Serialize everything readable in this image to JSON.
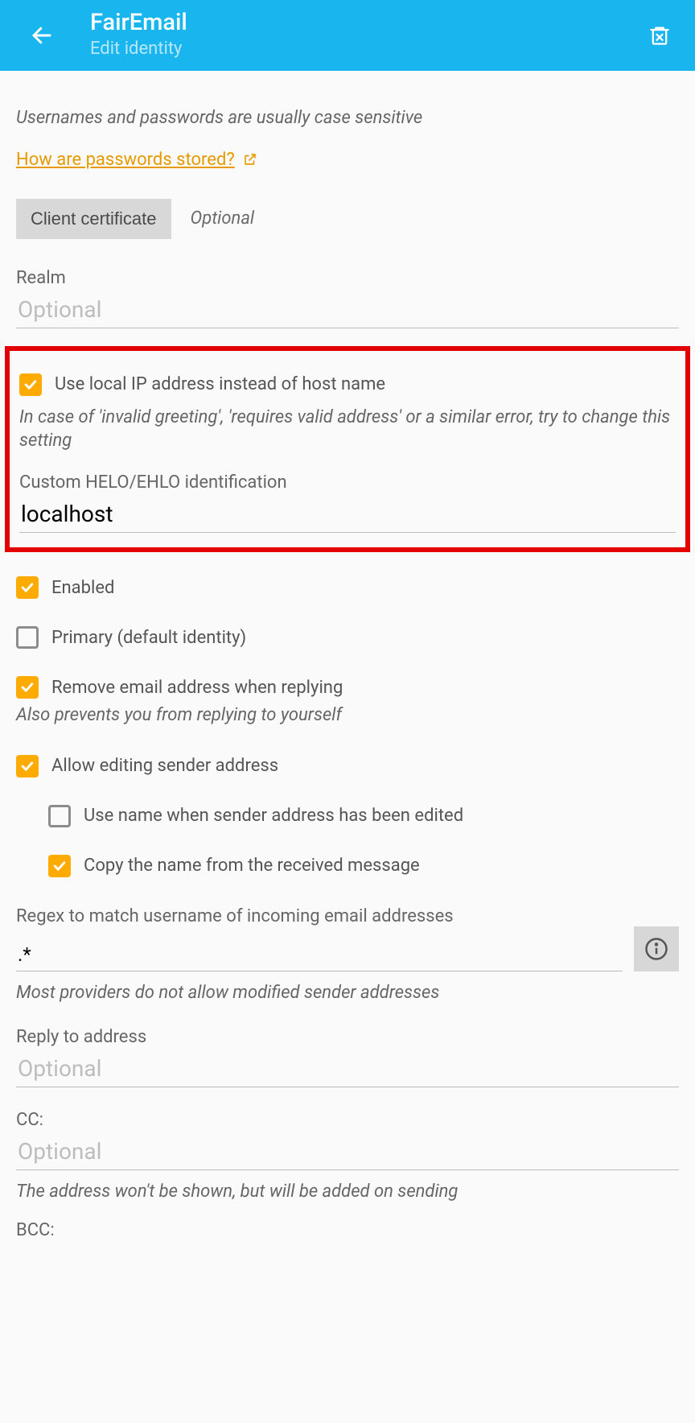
{
  "appbar": {
    "title": "FairEmail",
    "subtitle": "Edit identity"
  },
  "intro_note": "Usernames and passwords are usually case sensitive",
  "password_link": {
    "label": "How are passwords stored?"
  },
  "client_cert": {
    "button": "Client certificate",
    "hint": "Optional"
  },
  "realm": {
    "label": "Realm",
    "placeholder": "Optional",
    "value": ""
  },
  "highlight": {
    "use_local_ip": {
      "label": "Use local IP address instead of host name",
      "checked": true
    },
    "note": "In case of 'invalid greeting', 'requires valid address' or a similar error, try to change this setting",
    "helo": {
      "label": "Custom HELO/EHLO identification",
      "value": "localhost"
    }
  },
  "options": {
    "enabled": {
      "label": "Enabled",
      "checked": true
    },
    "primary": {
      "label": "Primary (default identity)",
      "checked": false
    },
    "remove_addr": {
      "label": "Remove email address when replying",
      "checked": true
    },
    "remove_addr_note": "Also prevents you from replying to yourself",
    "allow_edit_sender": {
      "label": "Allow editing sender address",
      "checked": true
    },
    "use_name_edited": {
      "label": "Use name when sender address has been edited",
      "checked": false
    },
    "copy_name": {
      "label": "Copy the name from the received message",
      "checked": true
    }
  },
  "regex": {
    "label": "Regex to match username of incoming email addresses",
    "value": ".*",
    "note": "Most providers do not allow modified sender addresses"
  },
  "reply_to": {
    "label": "Reply to address",
    "placeholder": "Optional",
    "value": ""
  },
  "cc": {
    "label": "CC:",
    "placeholder": "Optional",
    "value": "",
    "note": "The address won't be shown, but will be added on sending"
  },
  "bcc": {
    "label": "BCC:"
  }
}
